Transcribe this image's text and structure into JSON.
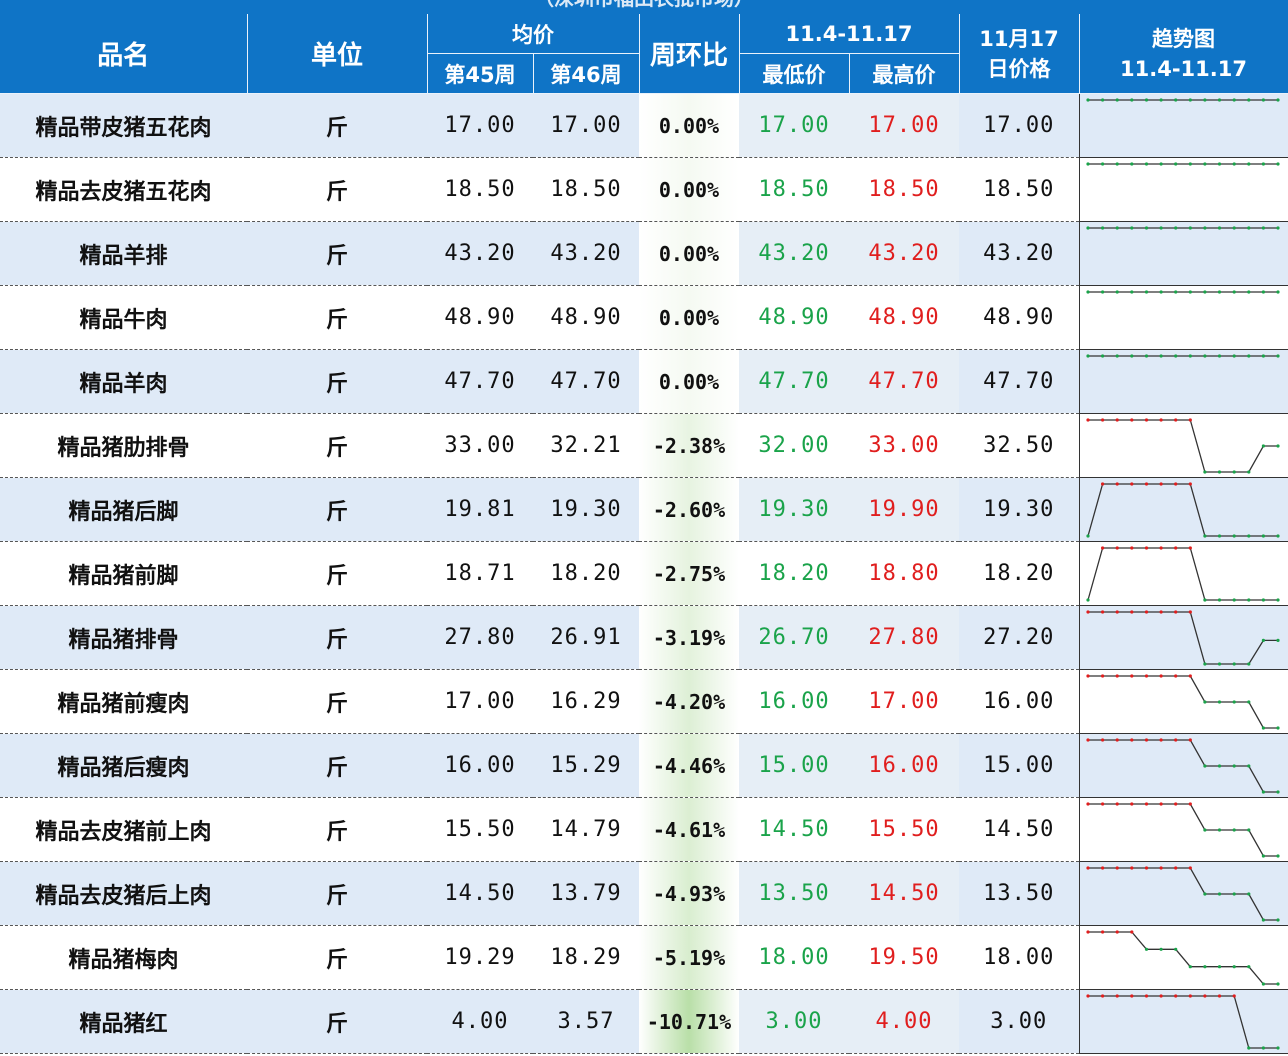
{
  "caption": "（深圳市福田农批市场）",
  "headers": {
    "name": "品名",
    "unit": "单位",
    "avg": "均价",
    "week45": "第45周",
    "week46": "第46周",
    "wow": "周环比",
    "range": "11.4-11.17",
    "min": "最低价",
    "max": "最高价",
    "day_price": "11月17日价格",
    "trend_title": "趋势图",
    "trend_range": "11.4-11.17"
  },
  "colors": {
    "header_bg": "#0f74c6",
    "low": "#1aa34a",
    "high": "#e01e1e",
    "row_alt": "#dfeaf7",
    "wow_tint": "#b9dfa8"
  },
  "rows": [
    {
      "name": "精品带皮猪五花肉",
      "unit": "斤",
      "w45": "17.00",
      "w46": "17.00",
      "wow": "0.00%",
      "wow_value": 0.0,
      "min": "17.00",
      "max": "17.00",
      "day": "17.00",
      "trend": [
        17,
        17,
        17,
        17,
        17,
        17,
        17,
        17,
        17,
        17,
        17,
        17,
        17,
        17
      ]
    },
    {
      "name": "精品去皮猪五花肉",
      "unit": "斤",
      "w45": "18.50",
      "w46": "18.50",
      "wow": "0.00%",
      "wow_value": 0.0,
      "min": "18.50",
      "max": "18.50",
      "day": "18.50",
      "trend": [
        18.5,
        18.5,
        18.5,
        18.5,
        18.5,
        18.5,
        18.5,
        18.5,
        18.5,
        18.5,
        18.5,
        18.5,
        18.5,
        18.5
      ]
    },
    {
      "name": "精品羊排",
      "unit": "斤",
      "w45": "43.20",
      "w46": "43.20",
      "wow": "0.00%",
      "wow_value": 0.0,
      "min": "43.20",
      "max": "43.20",
      "day": "43.20",
      "trend": [
        43.2,
        43.2,
        43.2,
        43.2,
        43.2,
        43.2,
        43.2,
        43.2,
        43.2,
        43.2,
        43.2,
        43.2,
        43.2,
        43.2
      ]
    },
    {
      "name": "精品牛肉",
      "unit": "斤",
      "w45": "48.90",
      "w46": "48.90",
      "wow": "0.00%",
      "wow_value": 0.0,
      "min": "48.90",
      "max": "48.90",
      "day": "48.90",
      "trend": [
        48.9,
        48.9,
        48.9,
        48.9,
        48.9,
        48.9,
        48.9,
        48.9,
        48.9,
        48.9,
        48.9,
        48.9,
        48.9,
        48.9
      ]
    },
    {
      "name": "精品羊肉",
      "unit": "斤",
      "w45": "47.70",
      "w46": "47.70",
      "wow": "0.00%",
      "wow_value": 0.0,
      "min": "47.70",
      "max": "47.70",
      "day": "47.70",
      "trend": [
        47.7,
        47.7,
        47.7,
        47.7,
        47.7,
        47.7,
        47.7,
        47.7,
        47.7,
        47.7,
        47.7,
        47.7,
        47.7,
        47.7
      ]
    },
    {
      "name": "精品猪肋排骨",
      "unit": "斤",
      "w45": "33.00",
      "w46": "32.21",
      "wow": "-2.38%",
      "wow_value": -2.38,
      "min": "32.00",
      "max": "33.00",
      "day": "32.50",
      "trend": [
        33,
        33,
        33,
        33,
        33,
        33,
        33,
        33,
        32,
        32,
        32,
        32,
        32.5,
        32.5
      ]
    },
    {
      "name": "精品猪后脚",
      "unit": "斤",
      "w45": "19.81",
      "w46": "19.30",
      "wow": "-2.60%",
      "wow_value": -2.6,
      "min": "19.30",
      "max": "19.90",
      "day": "19.30",
      "trend": [
        19.3,
        19.9,
        19.9,
        19.9,
        19.9,
        19.9,
        19.9,
        19.9,
        19.3,
        19.3,
        19.3,
        19.3,
        19.3,
        19.3
      ]
    },
    {
      "name": "精品猪前脚",
      "unit": "斤",
      "w45": "18.71",
      "w46": "18.20",
      "wow": "-2.75%",
      "wow_value": -2.75,
      "min": "18.20",
      "max": "18.80",
      "day": "18.20",
      "trend": [
        18.2,
        18.8,
        18.8,
        18.8,
        18.8,
        18.8,
        18.8,
        18.8,
        18.2,
        18.2,
        18.2,
        18.2,
        18.2,
        18.2
      ]
    },
    {
      "name": "精品猪排骨",
      "unit": "斤",
      "w45": "27.80",
      "w46": "26.91",
      "wow": "-3.19%",
      "wow_value": -3.19,
      "min": "26.70",
      "max": "27.80",
      "day": "27.20",
      "trend": [
        27.8,
        27.8,
        27.8,
        27.8,
        27.8,
        27.8,
        27.8,
        27.8,
        26.7,
        26.7,
        26.7,
        26.7,
        27.2,
        27.2
      ]
    },
    {
      "name": "精品猪前瘦肉",
      "unit": "斤",
      "w45": "17.00",
      "w46": "16.29",
      "wow": "-4.20%",
      "wow_value": -4.2,
      "min": "16.00",
      "max": "17.00",
      "day": "16.00",
      "trend": [
        17,
        17,
        17,
        17,
        17,
        17,
        17,
        17,
        16.5,
        16.5,
        16.5,
        16.5,
        16,
        16
      ]
    },
    {
      "name": "精品猪后瘦肉",
      "unit": "斤",
      "w45": "16.00",
      "w46": "15.29",
      "wow": "-4.46%",
      "wow_value": -4.46,
      "min": "15.00",
      "max": "16.00",
      "day": "15.00",
      "trend": [
        16,
        16,
        16,
        16,
        16,
        16,
        16,
        16,
        15.5,
        15.5,
        15.5,
        15.5,
        15,
        15
      ]
    },
    {
      "name": "精品去皮猪前上肉",
      "unit": "斤",
      "w45": "15.50",
      "w46": "14.79",
      "wow": "-4.61%",
      "wow_value": -4.61,
      "min": "14.50",
      "max": "15.50",
      "day": "14.50",
      "trend": [
        15.5,
        15.5,
        15.5,
        15.5,
        15.5,
        15.5,
        15.5,
        15.5,
        15,
        15,
        15,
        15,
        14.5,
        14.5
      ]
    },
    {
      "name": "精品去皮猪后上肉",
      "unit": "斤",
      "w45": "14.50",
      "w46": "13.79",
      "wow": "-4.93%",
      "wow_value": -4.93,
      "min": "13.50",
      "max": "14.50",
      "day": "13.50",
      "trend": [
        14.5,
        14.5,
        14.5,
        14.5,
        14.5,
        14.5,
        14.5,
        14.5,
        14,
        14,
        14,
        14,
        13.5,
        13.5
      ]
    },
    {
      "name": "精品猪梅肉",
      "unit": "斤",
      "w45": "19.29",
      "w46": "18.29",
      "wow": "-5.19%",
      "wow_value": -5.19,
      "min": "18.00",
      "max": "19.50",
      "day": "18.00",
      "trend": [
        19.5,
        19.5,
        19.5,
        19.5,
        19,
        19,
        19,
        18.5,
        18.5,
        18.5,
        18.5,
        18.5,
        18,
        18
      ]
    },
    {
      "name": "精品猪红",
      "unit": "斤",
      "w45": "4.00",
      "w46": "3.57",
      "wow": "-10.71%",
      "wow_value": -10.71,
      "min": "3.00",
      "max": "4.00",
      "day": "3.00",
      "trend": [
        4,
        4,
        4,
        4,
        4,
        4,
        4,
        4,
        4,
        4,
        4,
        3,
        3,
        3
      ]
    }
  ]
}
